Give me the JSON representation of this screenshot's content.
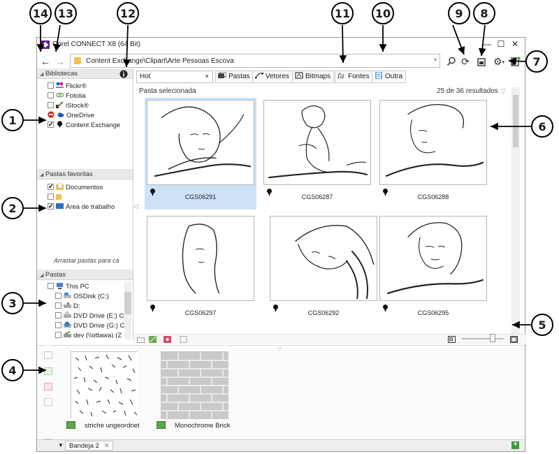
{
  "window": {
    "title": "Corel CONNECT X8 (64 Bit)",
    "minimize_glyph": "—",
    "maximize_glyph": "☐",
    "close_glyph": "✕"
  },
  "address": {
    "path": "Content Exchange\\Clipart\\Arte Pessoas Escova",
    "dropdown_glyph": "▾"
  },
  "icons": {
    "back": "←",
    "forward": "→",
    "search": "⚲",
    "refresh": "⟳",
    "settings": "⚙"
  },
  "libraries": {
    "header": "Bibliotecas",
    "items": [
      {
        "label": "Flickr®",
        "checked": false
      },
      {
        "label": "Fotolia",
        "checked": false
      },
      {
        "label": "iStock®",
        "checked": false
      },
      {
        "label": "OneDrive",
        "checked": false
      },
      {
        "label": "Content Exchange",
        "checked": true
      }
    ]
  },
  "favorites": {
    "header": "Pastas favoritas",
    "items": [
      {
        "label": "Documentos",
        "checked": true
      },
      {
        "label": "",
        "checked": false
      },
      {
        "label": "Área de trabalho",
        "checked": true
      }
    ],
    "drag_hint": "Arrastar pastas para cá"
  },
  "folders": {
    "header": "Pastas",
    "items": [
      {
        "label": "This PC"
      },
      {
        "label": "OSDisk (C:)"
      },
      {
        "label": "D:"
      },
      {
        "label": "DVD Drive (E:) CC"
      },
      {
        "label": "DVD Drive (G:) Cl"
      },
      {
        "label": "dev (\\\\ottawa) (Z"
      }
    ]
  },
  "toolbar": {
    "filter_value": "Hot",
    "buttons": [
      "Pastas",
      "Vetores",
      "Bitmaps",
      "Fontes",
      "Outra"
    ]
  },
  "content": {
    "selected_folder": "Pasta selecionada",
    "results": "25 de 36 resultados",
    "thumbnails": [
      "CGS06291",
      "CGS06287",
      "CGS06288",
      "CGS06297",
      "CGS06292",
      "CGS06295"
    ]
  },
  "tray": {
    "items": [
      "striche ungeordnet",
      "Monochrome Brick"
    ],
    "tab_label": "Bandeja 2",
    "tab_close": "✕",
    "add_glyph": "+"
  },
  "callouts": [
    "14",
    "13",
    "12",
    "11",
    "10",
    "9",
    "8",
    "7",
    "1",
    "2",
    "3",
    "4",
    "5",
    "6"
  ]
}
